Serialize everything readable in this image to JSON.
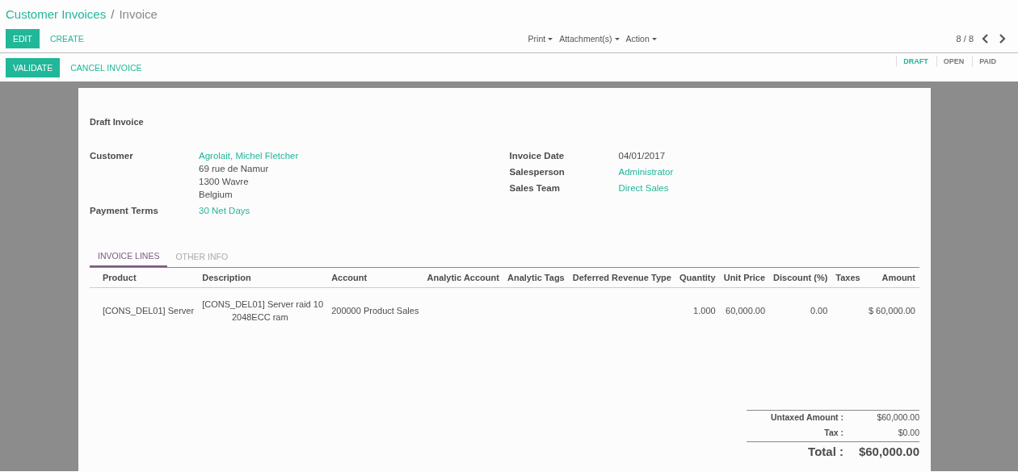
{
  "breadcrumb_separator": "/",
  "breadcrumb": [
    {
      "label": "Customer Invoices",
      "kind": "link"
    },
    {
      "label": "Invoice",
      "kind": "current"
    }
  ],
  "buttons": [
    {
      "label": "EDIT",
      "kind": "primary"
    },
    {
      "label": "CREATE",
      "kind": "link"
    }
  ],
  "menus": [
    "Print",
    "Attachment(s)",
    "Action"
  ],
  "pager": "8 / 8",
  "status_buttons": [
    {
      "label": "VALIDATE",
      "kind": "primary"
    },
    {
      "label": "CANCEL INVOICE",
      "kind": "link"
    }
  ],
  "statusbar": [
    {
      "label": "DRAFT",
      "selected": true
    },
    {
      "label": "OPEN",
      "selected": false
    },
    {
      "label": "PAID",
      "selected": false
    }
  ],
  "sheet": {
    "title": "Draft Invoice",
    "left_fields": [
      {
        "label": "Customer",
        "kind": "link",
        "value": "Agrolait, Michel Fletcher",
        "lines": [
          "69 rue de Namur",
          "1300 Wavre",
          "Belgium"
        ]
      },
      {
        "label": "Payment Terms",
        "kind": "link",
        "value": "30 Net Days"
      }
    ],
    "right_fields": [
      {
        "label": "Invoice Date",
        "kind": "text",
        "value": "04/01/2017"
      },
      {
        "label": "Salesperson",
        "kind": "link",
        "value": "Administrator"
      },
      {
        "label": "Sales Team",
        "kind": "link",
        "value": "Direct Sales"
      }
    ],
    "tabs": [
      {
        "label": "INVOICE LINES",
        "selected": true
      },
      {
        "label": "OTHER INFO",
        "selected": false
      }
    ],
    "table": {
      "columns": [
        "Product",
        "Description",
        "Account",
        "Analytic Account",
        "Analytic Tags",
        "Deferred Revenue Type",
        "Quantity",
        "Unit Price",
        "Discount (%)",
        "Taxes",
        "Amount"
      ],
      "rows": [
        [
          "[CONS_DEL01] Server",
          "[CONS_DEL01] Server raid 10\n            2048ECC ram",
          "200000 Product Sales",
          "",
          "",
          "",
          "1.000",
          "60,000.00",
          "0.00",
          "",
          "$ 60,000.00"
        ]
      ]
    },
    "totals": [
      {
        "label": "Untaxed Amount :",
        "value": "$60,000.00",
        "kind": "sub"
      },
      {
        "label": "Tax :",
        "value": "$0.00",
        "kind": "sub"
      },
      {
        "label": "Total :",
        "value": "$60,000.00",
        "kind": "total"
      }
    ]
  }
}
